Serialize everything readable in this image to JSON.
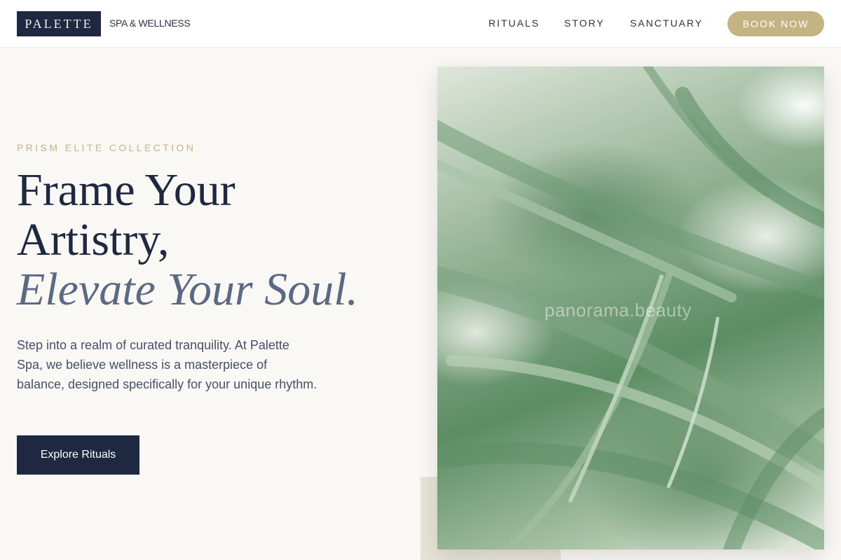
{
  "header": {
    "logo": "PALETTE",
    "logo_sub": "SPA & WELLNESS",
    "nav": [
      "RITUALS",
      "STORY",
      "SANCTUARY"
    ],
    "book_label": "BOOK NOW"
  },
  "hero": {
    "eyebrow": "PRISM ELITE COLLECTION",
    "headline_line1": "Frame Your",
    "headline_line2": "Artistry,",
    "headline_line3": "Elevate Your Soul.",
    "description": "Step into a realm of curated tranquility. At Palette Spa, we believe wellness is a masterpiece of balance, designed specifically for your unique rhythm.",
    "cta_label": "Explore Rituals",
    "image_icon": "palm-leaf-photo",
    "watermark": "panorama.beauty"
  },
  "colors": {
    "navy": "#1e2840",
    "gold": "#c5b383",
    "background": "#f9f8f5",
    "italic_slate": "#5a6a85"
  }
}
